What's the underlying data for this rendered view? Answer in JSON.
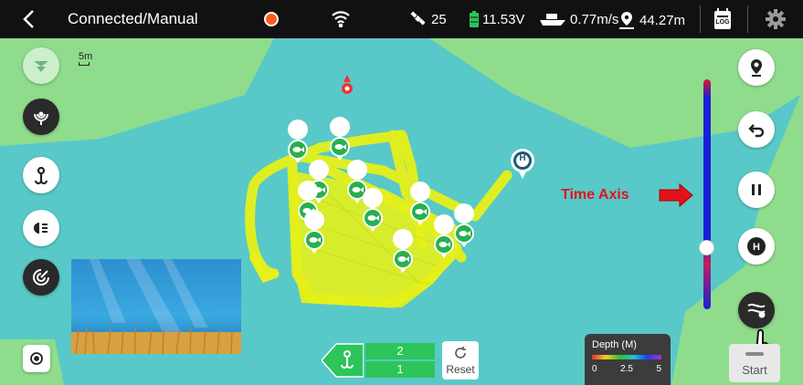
{
  "topbar": {
    "title": "Connected/Manual",
    "satellites": "25",
    "voltage": "11.53V",
    "speed": "0.77m/s",
    "distance": "44.27m",
    "log_label": "LOG"
  },
  "map": {
    "scale_label": "5m",
    "annotation": "Time Axis",
    "home_marker_label": "H"
  },
  "hook_counter": {
    "top_value": "2",
    "bottom_value": "1"
  },
  "reset_label": "Reset",
  "depth_legend": {
    "title": "Depth (M)",
    "ticks": [
      "0",
      "2.5",
      "5"
    ]
  },
  "start_label": "Start",
  "colors": {
    "water": "#58c9c8",
    "land": "#8fdc8c",
    "track": "#e6f01a",
    "fish_marker": "#27b04e",
    "annotation": "#e3121b"
  },
  "timeline_position": 0.73
}
